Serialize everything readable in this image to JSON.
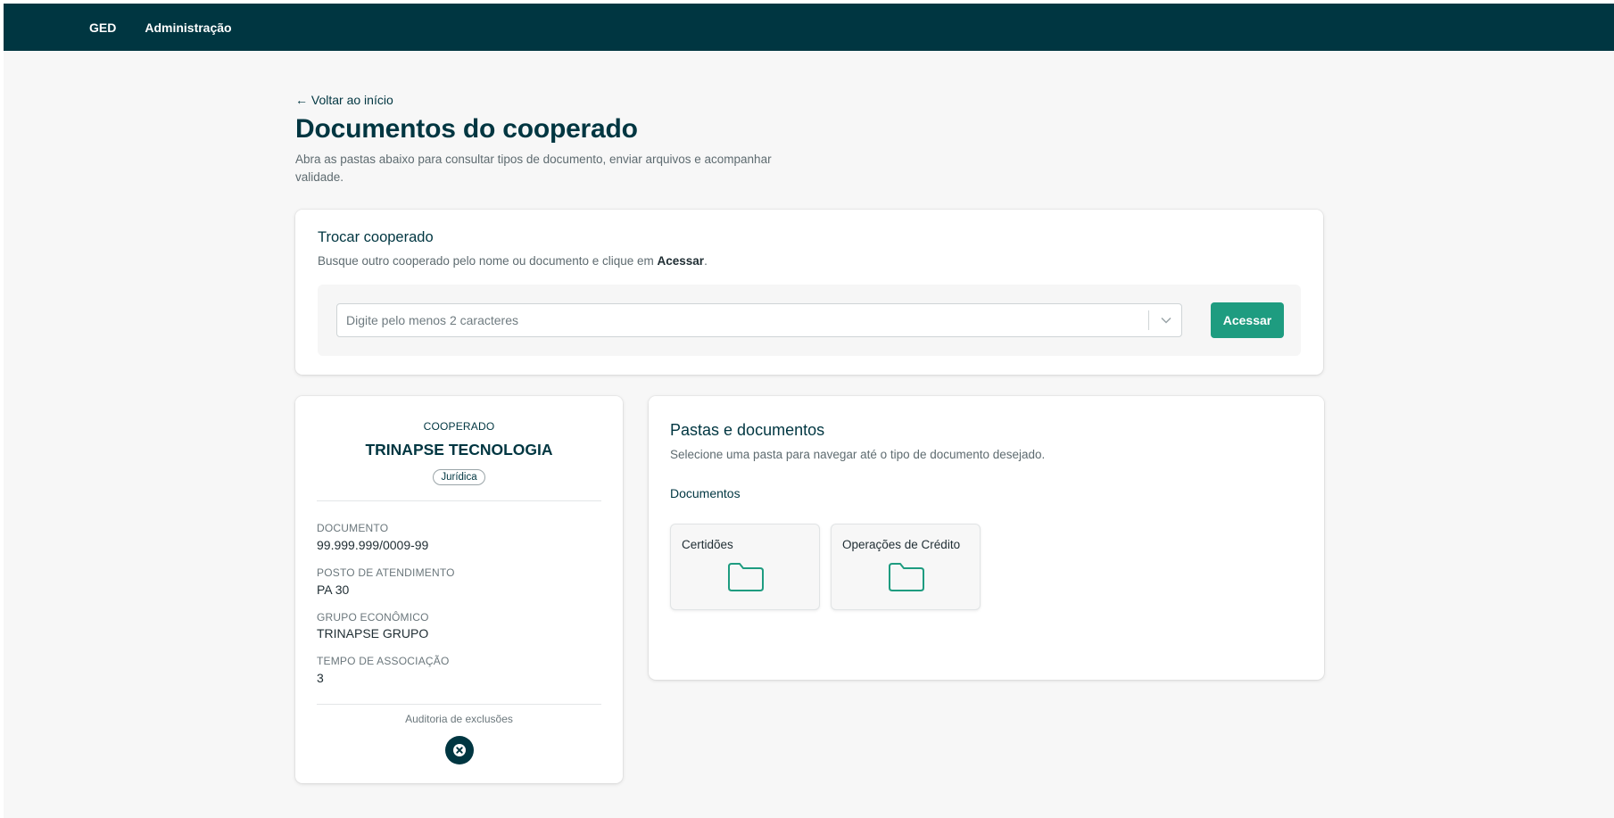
{
  "topbar": {
    "items": [
      {
        "label": "GED"
      },
      {
        "label": "Administração"
      }
    ]
  },
  "page": {
    "back_link": "← Voltar ao início",
    "title": "Documentos do cooperado",
    "subtitle": "Abra as pastas abaixo para consultar tipos de documento, enviar arquivos e acompanhar validade."
  },
  "switch_card": {
    "title": "Trocar cooperado",
    "description_prefix": "Busque outro cooperado pelo nome ou documento e clique em ",
    "description_bold": "Acessar",
    "description_suffix": ".",
    "search_placeholder": "Digite pelo menos 2 caracteres",
    "search_value": "",
    "button_label": "Acessar"
  },
  "cooperado": {
    "label": "COOPERADO",
    "name": "TRINAPSE TECNOLOGIA",
    "badge": "Jurídica",
    "fields": [
      {
        "label": "DOCUMENTO",
        "value": "99.999.999/0009-99"
      },
      {
        "label": "POSTO DE ATENDIMENTO",
        "value": "PA 30"
      },
      {
        "label": "GRUPO ECONÔMICO",
        "value": "TRINAPSE GRUPO"
      },
      {
        "label": "TEMPO DE ASSOCIAÇÃO",
        "value": "3"
      }
    ],
    "audit_label": "Auditoria de exclusões",
    "audit_icon": "close-circle-icon"
  },
  "folders": {
    "title": "Pastas e documentos",
    "description": "Selecione uma pasta para navegar até o tipo de documento desejado.",
    "section_label": "Documentos",
    "items": [
      {
        "label": "Certidões",
        "icon": "folder-icon"
      },
      {
        "label": "Operações de Crédito",
        "icon": "folder-icon"
      }
    ]
  },
  "colors": {
    "brand_dark": "#003641",
    "accent_green": "#1e9c80",
    "background": "#f7f7f7"
  }
}
